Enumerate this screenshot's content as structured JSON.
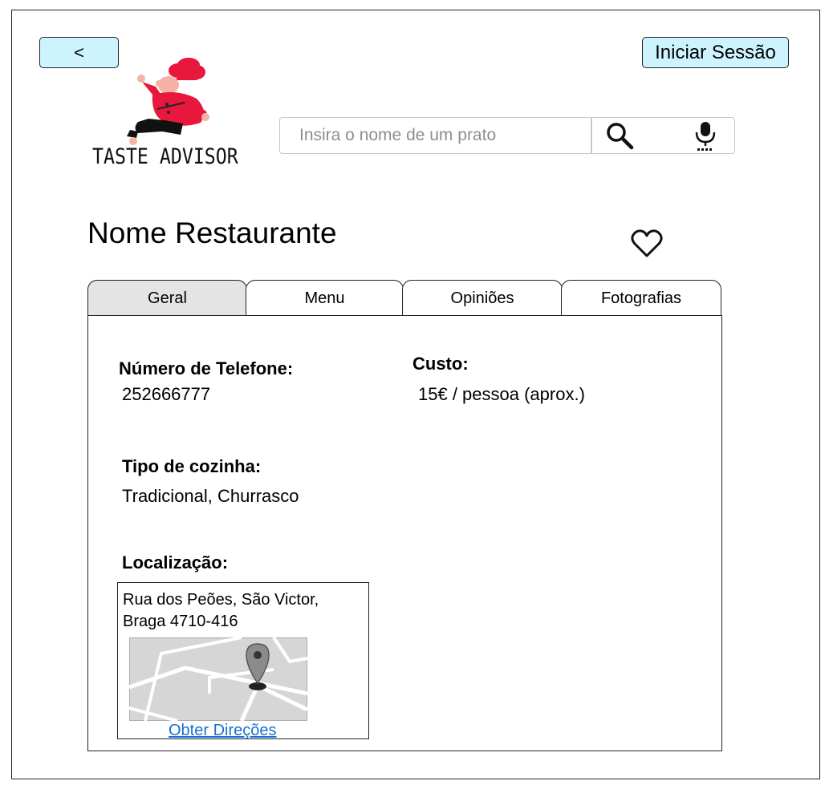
{
  "header": {
    "back_label": "<",
    "login_label": "Iniciar Sessão",
    "logo_text": "TASTE ADVISOR"
  },
  "search": {
    "placeholder": "Insira o nome de um prato",
    "search_icon": "search-icon",
    "mic_icon": "microphone-icon"
  },
  "restaurant": {
    "name": "Nome Restaurante",
    "favorite_icon": "heart-icon"
  },
  "tabs": [
    {
      "label": "Geral",
      "active": true
    },
    {
      "label": "Menu",
      "active": false
    },
    {
      "label": "Opiniões",
      "active": false
    },
    {
      "label": "Fotografias",
      "active": false
    }
  ],
  "details": {
    "phone_label": "Número de Telefone:",
    "phone_value": "252666777",
    "cost_label": "Custo:",
    "cost_value": "15€ / pessoa (aprox.)",
    "cuisine_label": "Tipo de cozinha:",
    "cuisine_value": "Tradicional, Churrasco",
    "location_label": "Localização:",
    "address_line1": "Rua dos Peões,  São Victor,",
    "address_line2": "Braga 4710-416",
    "directions_label": "Obter Direções"
  },
  "colors": {
    "button_bg": "#cdf3ff",
    "active_tab_bg": "#e4e4e4",
    "link": "#1a6fd6",
    "chef_red": "#e8173d"
  }
}
